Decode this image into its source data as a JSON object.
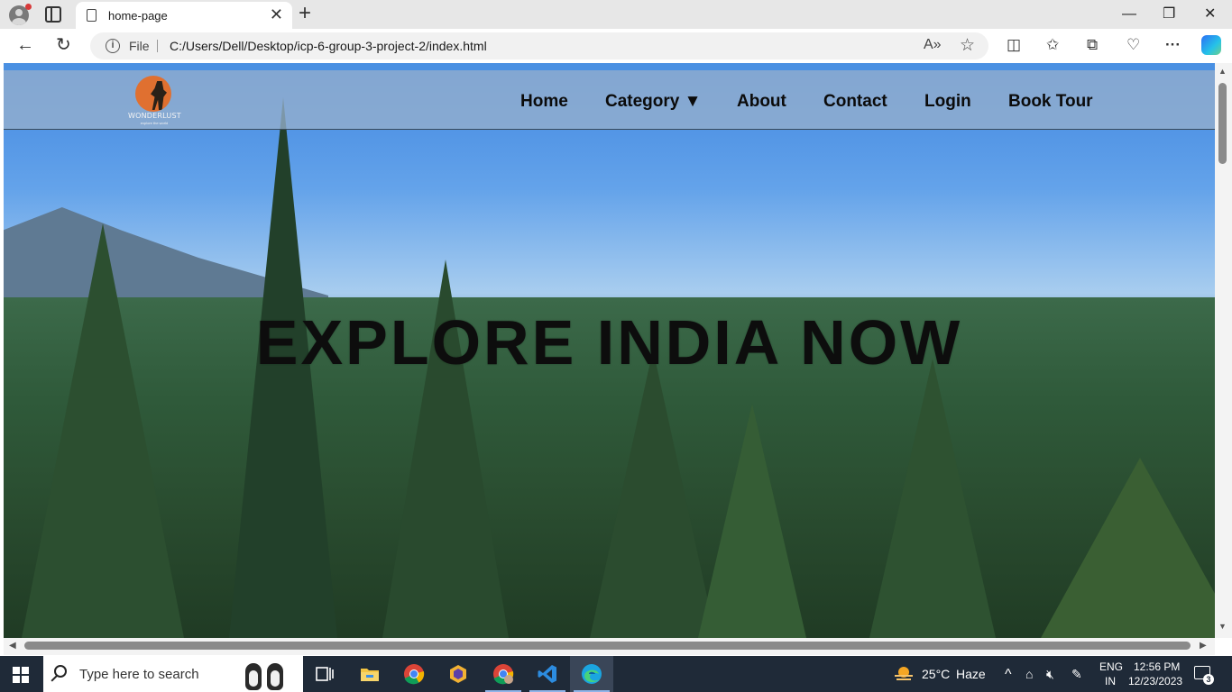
{
  "browser": {
    "tab_title": "home-page",
    "tab_close": "✕",
    "new_tab": "+",
    "window_controls": {
      "minimize": "—",
      "restore": "❐",
      "close": "✕"
    },
    "nav": {
      "back": "←",
      "reload": "↻"
    },
    "address": {
      "scheme_label": "File",
      "url": "C:/Users/Dell/Desktop/icp-6-group-3-project-2/index.html",
      "info_glyph": "i"
    },
    "toolbar_icons": [
      "read-aloud-icon",
      "favorite-star-icon",
      "split-screen-icon",
      "favorites-icon",
      "collections-icon",
      "browser-essentials-icon",
      "more-menu-icon",
      "copilot-icon"
    ],
    "toolbar_glyphs": {
      "read_aloud": "A»",
      "star": "☆",
      "split": "◫",
      "favorites": "✩",
      "collections": "⧉",
      "essentials": "♡",
      "more": "···"
    }
  },
  "site": {
    "logo": {
      "brand": "WONDERLUST",
      "tagline": "explore the world"
    },
    "menu": [
      {
        "label": "Home"
      },
      {
        "label": "Category ▼"
      },
      {
        "label": "About"
      },
      {
        "label": "Contact"
      },
      {
        "label": "Login"
      },
      {
        "label": "Book Tour"
      }
    ],
    "hero_title": "EXPLORE INDIA NOW"
  },
  "scrollbars": {
    "up": "▲",
    "down": "▼",
    "left": "◀",
    "right": "▶"
  },
  "taskbar": {
    "search_placeholder": "Type here to search",
    "apps": [
      "task-view-icon",
      "file-explorer-icon",
      "chrome-icon",
      "app-hexagon-icon",
      "chrome-profile-icon",
      "vscode-icon",
      "edge-icon"
    ],
    "weather": {
      "temp": "25°C",
      "condition": "Haze"
    },
    "language": {
      "line1": "ENG",
      "line2": "IN"
    },
    "clock": {
      "time": "12:56 PM",
      "date": "12/23/2023"
    },
    "notifications_count": "3",
    "tray_glyphs": {
      "chevron": "^",
      "network": "⌂",
      "volume": "🔇︎",
      "pen": "✎"
    }
  }
}
